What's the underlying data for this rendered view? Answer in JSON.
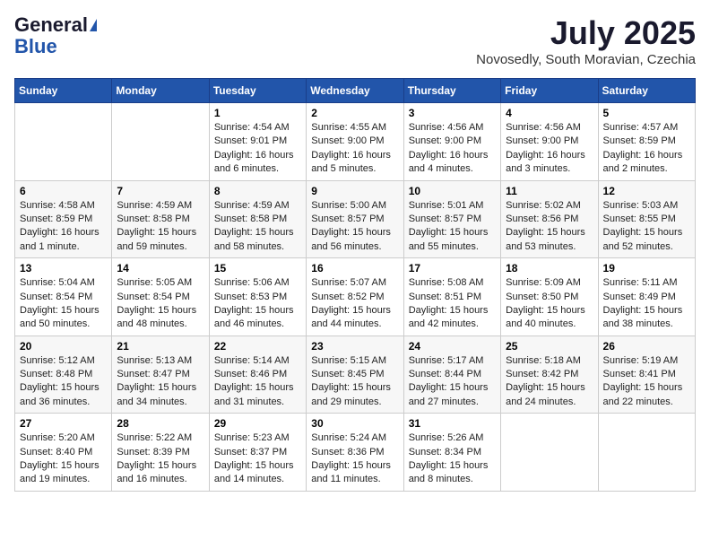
{
  "logo": {
    "general": "General",
    "blue": "Blue"
  },
  "title": {
    "month_year": "July 2025",
    "location": "Novosedly, South Moravian, Czechia"
  },
  "days_of_week": [
    "Sunday",
    "Monday",
    "Tuesday",
    "Wednesday",
    "Thursday",
    "Friday",
    "Saturday"
  ],
  "weeks": [
    [
      {
        "day": "",
        "info": ""
      },
      {
        "day": "",
        "info": ""
      },
      {
        "day": "1",
        "info": "Sunrise: 4:54 AM\nSunset: 9:01 PM\nDaylight: 16 hours and 6 minutes."
      },
      {
        "day": "2",
        "info": "Sunrise: 4:55 AM\nSunset: 9:00 PM\nDaylight: 16 hours and 5 minutes."
      },
      {
        "day": "3",
        "info": "Sunrise: 4:56 AM\nSunset: 9:00 PM\nDaylight: 16 hours and 4 minutes."
      },
      {
        "day": "4",
        "info": "Sunrise: 4:56 AM\nSunset: 9:00 PM\nDaylight: 16 hours and 3 minutes."
      },
      {
        "day": "5",
        "info": "Sunrise: 4:57 AM\nSunset: 8:59 PM\nDaylight: 16 hours and 2 minutes."
      }
    ],
    [
      {
        "day": "6",
        "info": "Sunrise: 4:58 AM\nSunset: 8:59 PM\nDaylight: 16 hours and 1 minute."
      },
      {
        "day": "7",
        "info": "Sunrise: 4:59 AM\nSunset: 8:58 PM\nDaylight: 15 hours and 59 minutes."
      },
      {
        "day": "8",
        "info": "Sunrise: 4:59 AM\nSunset: 8:58 PM\nDaylight: 15 hours and 58 minutes."
      },
      {
        "day": "9",
        "info": "Sunrise: 5:00 AM\nSunset: 8:57 PM\nDaylight: 15 hours and 56 minutes."
      },
      {
        "day": "10",
        "info": "Sunrise: 5:01 AM\nSunset: 8:57 PM\nDaylight: 15 hours and 55 minutes."
      },
      {
        "day": "11",
        "info": "Sunrise: 5:02 AM\nSunset: 8:56 PM\nDaylight: 15 hours and 53 minutes."
      },
      {
        "day": "12",
        "info": "Sunrise: 5:03 AM\nSunset: 8:55 PM\nDaylight: 15 hours and 52 minutes."
      }
    ],
    [
      {
        "day": "13",
        "info": "Sunrise: 5:04 AM\nSunset: 8:54 PM\nDaylight: 15 hours and 50 minutes."
      },
      {
        "day": "14",
        "info": "Sunrise: 5:05 AM\nSunset: 8:54 PM\nDaylight: 15 hours and 48 minutes."
      },
      {
        "day": "15",
        "info": "Sunrise: 5:06 AM\nSunset: 8:53 PM\nDaylight: 15 hours and 46 minutes."
      },
      {
        "day": "16",
        "info": "Sunrise: 5:07 AM\nSunset: 8:52 PM\nDaylight: 15 hours and 44 minutes."
      },
      {
        "day": "17",
        "info": "Sunrise: 5:08 AM\nSunset: 8:51 PM\nDaylight: 15 hours and 42 minutes."
      },
      {
        "day": "18",
        "info": "Sunrise: 5:09 AM\nSunset: 8:50 PM\nDaylight: 15 hours and 40 minutes."
      },
      {
        "day": "19",
        "info": "Sunrise: 5:11 AM\nSunset: 8:49 PM\nDaylight: 15 hours and 38 minutes."
      }
    ],
    [
      {
        "day": "20",
        "info": "Sunrise: 5:12 AM\nSunset: 8:48 PM\nDaylight: 15 hours and 36 minutes."
      },
      {
        "day": "21",
        "info": "Sunrise: 5:13 AM\nSunset: 8:47 PM\nDaylight: 15 hours and 34 minutes."
      },
      {
        "day": "22",
        "info": "Sunrise: 5:14 AM\nSunset: 8:46 PM\nDaylight: 15 hours and 31 minutes."
      },
      {
        "day": "23",
        "info": "Sunrise: 5:15 AM\nSunset: 8:45 PM\nDaylight: 15 hours and 29 minutes."
      },
      {
        "day": "24",
        "info": "Sunrise: 5:17 AM\nSunset: 8:44 PM\nDaylight: 15 hours and 27 minutes."
      },
      {
        "day": "25",
        "info": "Sunrise: 5:18 AM\nSunset: 8:42 PM\nDaylight: 15 hours and 24 minutes."
      },
      {
        "day": "26",
        "info": "Sunrise: 5:19 AM\nSunset: 8:41 PM\nDaylight: 15 hours and 22 minutes."
      }
    ],
    [
      {
        "day": "27",
        "info": "Sunrise: 5:20 AM\nSunset: 8:40 PM\nDaylight: 15 hours and 19 minutes."
      },
      {
        "day": "28",
        "info": "Sunrise: 5:22 AM\nSunset: 8:39 PM\nDaylight: 15 hours and 16 minutes."
      },
      {
        "day": "29",
        "info": "Sunrise: 5:23 AM\nSunset: 8:37 PM\nDaylight: 15 hours and 14 minutes."
      },
      {
        "day": "30",
        "info": "Sunrise: 5:24 AM\nSunset: 8:36 PM\nDaylight: 15 hours and 11 minutes."
      },
      {
        "day": "31",
        "info": "Sunrise: 5:26 AM\nSunset: 8:34 PM\nDaylight: 15 hours and 8 minutes."
      },
      {
        "day": "",
        "info": ""
      },
      {
        "day": "",
        "info": ""
      }
    ]
  ]
}
